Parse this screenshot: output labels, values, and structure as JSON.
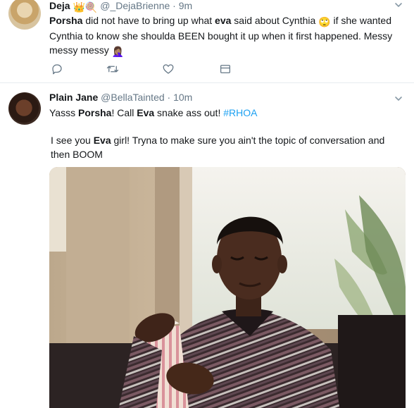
{
  "tweets": [
    {
      "name": "Deja",
      "handle": "@_DejaBrienne",
      "separator": "·",
      "time": "9m",
      "name_emojis": "👑🍭",
      "text": {
        "s1": "Porsha",
        "s2": " did not have to bring up what ",
        "s3": "eva",
        "s4": " said about Cynthia ",
        "s5": "🙄",
        "s6": " if she wanted Cynthia to know she shoulda BEEN bought it up when it first happened. Messy messy messy ",
        "s7": "🤦🏽‍♀️"
      }
    },
    {
      "name": "Plain Jane",
      "handle": "@BellaTainted",
      "separator": "·",
      "time": "10m",
      "text": {
        "s1": "Yasss ",
        "s2": "Porsha",
        "s3": "! Call ",
        "s4": "Eva",
        "s5": " snake ass out! ",
        "s6": "#RHOA"
      },
      "text2": {
        "s1": "I see you ",
        "s2": "Eva",
        "s3": " girl! Tryna to make sure you ain't the topic of conversation and then BOOM"
      }
    }
  ],
  "icons": {
    "reply": "reply-icon",
    "retweet": "retweet-icon",
    "like": "heart-icon",
    "dm": "mail-icon",
    "caret": "chevron-down-icon"
  },
  "colors": {
    "link": "#1da1f2",
    "secondary": "#657786",
    "divider": "#e6ecf0"
  }
}
